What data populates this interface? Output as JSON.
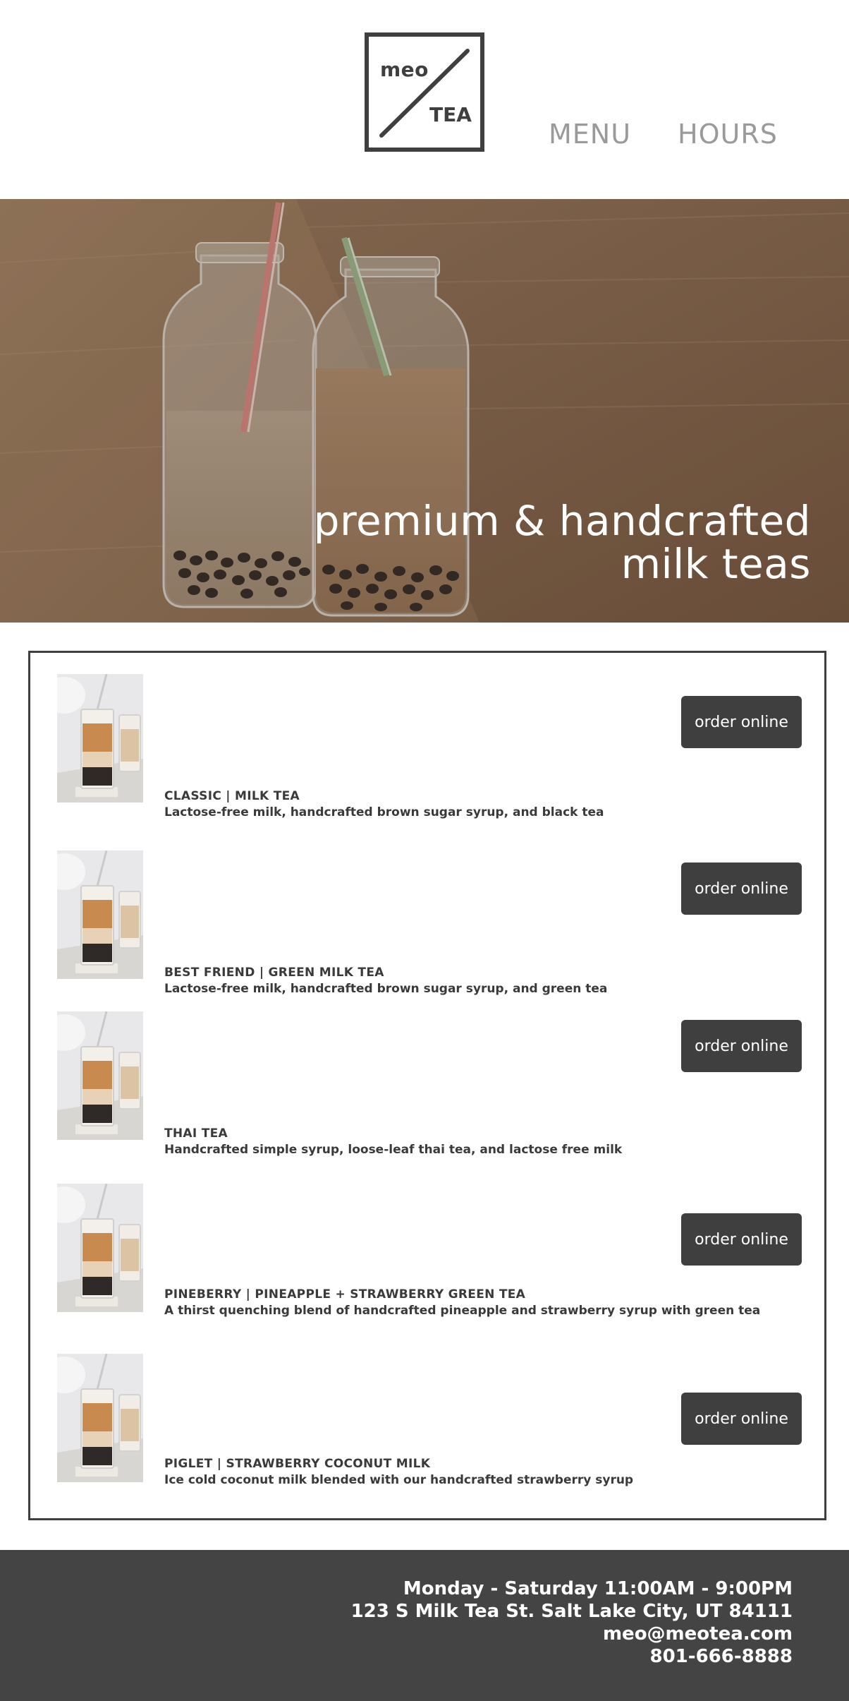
{
  "brand": {
    "logo_top": "meo",
    "logo_bottom": "TEA"
  },
  "nav": {
    "menu_label": "MENU",
    "hours_label": "HOURS"
  },
  "hero": {
    "line1": "premium & handcrafted",
    "line2": "milk teas"
  },
  "menu": {
    "order_label": "order online",
    "items": [
      {
        "name": "CLASSIC | MILK TEA",
        "description": "Lactose-free milk, handcrafted brown sugar syrup, and black tea"
      },
      {
        "name": "BEST FRIEND | GREEN MILK TEA",
        "description": "Lactose-free milk, handcrafted brown sugar syrup, and green tea"
      },
      {
        "name": "THAI TEA",
        "description": "Handcrafted simple syrup, loose-leaf thai tea, and lactose free milk"
      },
      {
        "name": "PINEBERRY | PINEAPPLE + STRAWBERRY GREEN TEA",
        "description": "A thirst quenching blend of handcrafted pineapple and strawberry syrup with green tea"
      },
      {
        "name": "PIGLET | STRAWBERRY COCONUT MILK",
        "description": "Ice cold coconut milk blended with our handcrafted strawberry syrup"
      }
    ]
  },
  "footer": {
    "hours": "Monday - Saturday 11:00AM - 9:00PM",
    "address": "123 S Milk Tea St. Salt Lake City, UT 84111",
    "email": "meo@meotea.com",
    "phone": "801-666-8888"
  },
  "colors": {
    "dark": "#3f3f3f",
    "nav_gray": "#9a9a9a",
    "footer_bg": "#444444",
    "hero_wood": "#8c6a4f"
  },
  "icons": {
    "logo": "meo-tea-logo",
    "hero_photo": "milk-tea-bottles-photo",
    "thumb_photo": "milk-tea-glass-photo"
  }
}
